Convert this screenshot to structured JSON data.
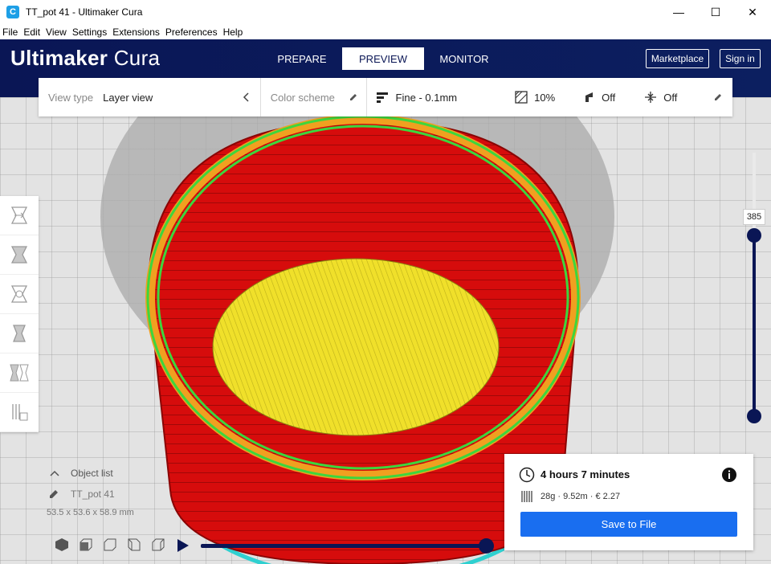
{
  "window": {
    "icon_letter": "C",
    "title": "TT_pot 41  - Ultimaker Cura",
    "minimize": "—",
    "maximize": "☐",
    "close": "✕"
  },
  "menu": [
    "File",
    "Edit",
    "View",
    "Settings",
    "Extensions",
    "Preferences",
    "Help"
  ],
  "header": {
    "brand_bold": "Ultimaker",
    "brand_light": "Cura",
    "tabs": [
      "PREPARE",
      "PREVIEW",
      "MONITOR"
    ],
    "active_tab": "PREVIEW",
    "marketplace": "Marketplace",
    "sign_in": "Sign in"
  },
  "settings_bar": {
    "view_type_label": "View type",
    "view_type_value": "Layer view",
    "color_scheme": "Color scheme",
    "profile": "Fine - 0.1mm",
    "infill": "10%",
    "support": "Off",
    "adhesion": "Off"
  },
  "layer_slider": {
    "value": "385"
  },
  "object_list": {
    "header": "Object list",
    "object_name": "TT_pot 41",
    "dimensions": "53.5 x 53.6 x 58.9 mm"
  },
  "print_info": {
    "time": "4 hours 7 minutes",
    "material": "28g · 9.52m · € 2.27",
    "save_button": "Save to File"
  },
  "colors": {
    "header": "#0a1655",
    "accent": "#196ef0",
    "wall": "#e01010",
    "infill": "#f0e02a",
    "inner_wall": "#3dd63d",
    "skirt": "#2fd0d0",
    "support_orange": "#f0a020"
  }
}
